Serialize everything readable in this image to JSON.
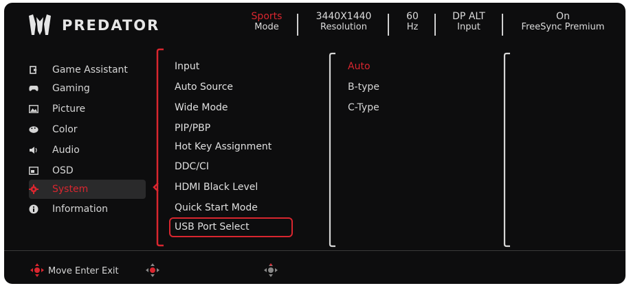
{
  "brand": {
    "name": "PREDATOR"
  },
  "header": {
    "stats": [
      {
        "value": "Sports",
        "label": "Mode",
        "highlight": true
      },
      {
        "value": "3440X1440",
        "label": "Resolution",
        "highlight": false
      },
      {
        "value": "60",
        "label": "Hz",
        "highlight": false
      },
      {
        "value": "DP ALT",
        "label": "Input",
        "highlight": false
      },
      {
        "value": "On",
        "label": "FreeSync Premium",
        "highlight": false
      }
    ]
  },
  "sidebar": {
    "items": [
      {
        "label": "Game Assistant",
        "icon": "game-assistant-icon",
        "active": false
      },
      {
        "label": "Gaming",
        "icon": "gamepad-icon",
        "active": false
      },
      {
        "label": "Picture",
        "icon": "picture-icon",
        "active": false
      },
      {
        "label": "Color",
        "icon": "palette-icon",
        "active": false
      },
      {
        "label": "Audio",
        "icon": "speaker-icon",
        "active": false
      },
      {
        "label": "OSD",
        "icon": "osd-icon",
        "active": false
      },
      {
        "label": "System",
        "icon": "gear-icon",
        "active": true
      },
      {
        "label": "Information",
        "icon": "info-icon",
        "active": false
      }
    ]
  },
  "menu": {
    "items": [
      "Input",
      "Auto Source",
      "Wide Mode",
      "PIP/PBP",
      "Hot Key Assignment",
      "DDC/CI",
      "HDMI Black Level",
      "Quick Start Mode",
      "USB Port Select"
    ],
    "selected_index": 8
  },
  "options": {
    "items": [
      "Auto",
      "B-type",
      "C-Type"
    ],
    "active_index": 0
  },
  "footer": {
    "hint": "Move Enter Exit"
  },
  "colors": {
    "accent": "#d9262f",
    "background": "#0d0d0e",
    "text": "#dcdcdc"
  }
}
